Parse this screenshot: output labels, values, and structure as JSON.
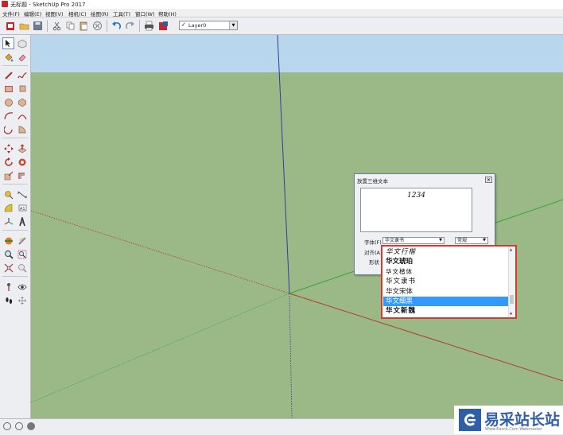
{
  "window": {
    "title": "无标题 - SketchUp Pro 2017"
  },
  "menu": [
    "文件(F)",
    "编辑(E)",
    "视图(V)",
    "相机(C)",
    "绘图(R)",
    "工具(T)",
    "窗口(W)",
    "帮助(H)"
  ],
  "toolbar": {
    "layer_value": "Layer0",
    "layer_check": "✓"
  },
  "colors": {
    "sky": "#b9d7ec",
    "ground": "#9bb986",
    "axis_blue": "#2b3f9c",
    "axis_red": "#b23a2a",
    "axis_green": "#3aa63a",
    "highlight": "#3399ff",
    "callout_border": "#d43b2f"
  },
  "dialog": {
    "title": "放置三维文本",
    "text_value": "1234",
    "font_label": "字体(F)",
    "font_value": "华文隶书",
    "style_value": "常规",
    "align_label": "对齐(A)",
    "shape_label": "形状"
  },
  "font_list": {
    "items": [
      "华文行楷",
      "华文琥珀",
      "华文楷体",
      "华文隶书",
      "华文宋体",
      "华文细黑",
      "华文新魏"
    ],
    "selected": "华文细黑"
  },
  "watermark": {
    "text": "易采站长站",
    "sub": "Www.Easck.Com Webmaster"
  }
}
